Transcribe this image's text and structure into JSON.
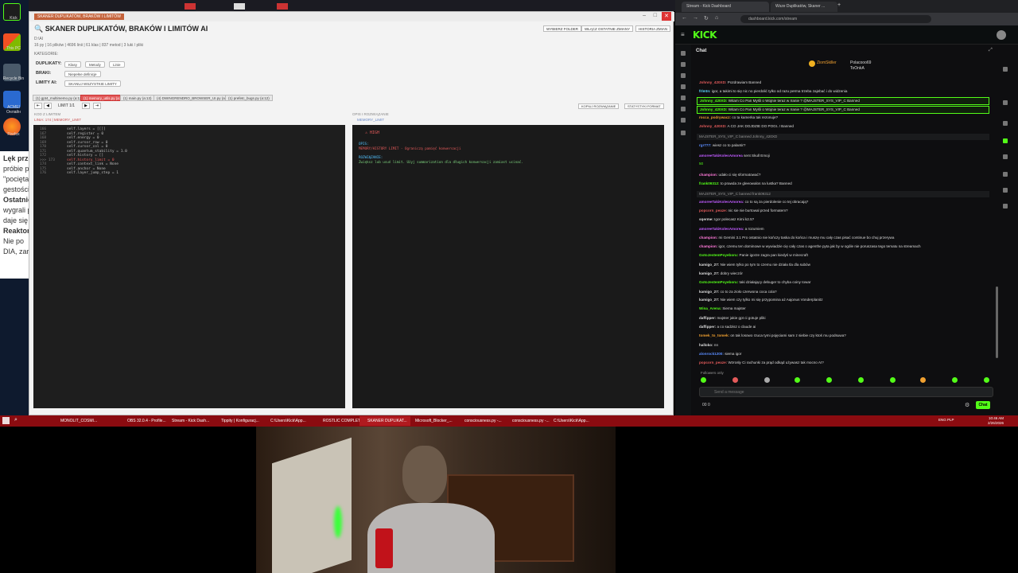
{
  "desktop": {
    "icons": [
      "Kick",
      "This PC",
      "Recycle Bin",
      "ACMEI Онлайн",
      "Firefox"
    ],
    "bg_lines": [
      "Lęk przed",
      "próbie pa",
      "\"pocięta\"",
      "gestości",
      "Ostatnio",
      "wygrali p",
      "daje się",
      "Reaktor",
      "Nie po",
      "DIA, zar"
    ]
  },
  "scanner": {
    "title_tag": "SKANER DUPLIKATÓW, BRAKÓW I LIMITÓW",
    "heading": "🔍 SKANER DUPLIKATÓW, BRAKÓW I LIMITÓW AI",
    "sub1": "D:\\AI",
    "sub2": "16 py | 16 plików | 4696 linii | 61 klas | 837 metod | 3 luki / pliki",
    "top_buttons": [
      "WYBIERZ FOLDER",
      "WŁĄCZ OSTATNIE ZMIANY",
      "HISTORIA ZMIAN"
    ],
    "kategorie": "KATEGORIE:",
    "rows": [
      {
        "label": "DUPLIKATY:",
        "chips": [
          "Klasy",
          "Metody",
          "Linie"
        ]
      },
      {
        "label": "BRAKI:",
        "chips": [
          "Niepełne definicje"
        ]
      },
      {
        "label": "LIMITY AI:",
        "chips": [
          "SKANUJ WSZYSTKIE LIMITY"
        ]
      }
    ],
    "file_tabs": [
      "(1) gpt4_multimemo.py (a:12)",
      "(1) memory_utils.py (a:2)",
      "(1) main.py (a:13)",
      "(4) DWINGRENDRO_BROWSER_UI.py (a:15)",
      "(1) prefetc_bugs.py (a:12)"
    ],
    "limit_label": "LIMIT 1/1",
    "nav": [
      "⇤",
      "◀",
      "▶",
      "⇥"
    ],
    "right_buttons": [
      "KOPIUJ ROZWIĄZANIE",
      "STATYSTYKI FORMAT"
    ],
    "left_head": "KOD Z LIMITEM",
    "left_sub": "LINIA: 174 | MEMORY_LIMIT",
    "right_head": "OPIS I ROZWIĄZANIE",
    "right_sub": "MEMORY_LIMIT",
    "code_lines": [
      {
        "n": "166",
        "t": "self.layers = [[]]"
      },
      {
        "n": "167",
        "t": "self.register = 0"
      },
      {
        "n": "168",
        "t": "self.energy = 0"
      },
      {
        "n": "169",
        "t": "self.cursor_row = 0"
      },
      {
        "n": "170",
        "t": "self.cursor_col = 0"
      },
      {
        "n": "171",
        "t": "self.quantum_stability = 1.0"
      },
      {
        "n": "172",
        "t": "self.history = []"
      },
      {
        "n": ">>> 173",
        "t": "self.history_limit = 0"
      },
      {
        "n": "174",
        "t": "self.context_link = None"
      },
      {
        "n": "175",
        "t": "self.anchor = None"
      },
      {
        "n": "176",
        "t": "self.layer_jump_step = 1"
      }
    ],
    "severity": "⚠ HIGH",
    "desc_label": "OPIS:",
    "desc_text": "MEMORY/HISTORY LIMIT - Ograniczą pamięć konwersacji",
    "fix_label": "ROZWIĄZANIE:",
    "fix_text": "Zwiększ lub usuń limit. Użyj summarization dla długich konwersacji zamiast ucinać."
  },
  "browser": {
    "tabs": [
      "Stream - Kick Dashboard",
      "Wsze Duplikatów, Skaner ...",
      "+"
    ],
    "url": "dashboard.kick.com/stream",
    "logo": "KICK",
    "chat_title": "Chat",
    "pinned": [
      "ZiomSkiller",
      "Polacooo69",
      "ToOnkA"
    ],
    "messages": [
      {
        "u": "Johnny_420XD:",
        "c": "#e05a5a",
        "t": "Pozdrawiam Banned",
        "style": ""
      },
      {
        "u": "frlmtn:",
        "c": "#5bd6ff",
        "t": "igor, a takimi to się nic no pierdolić tylko od razu perma trzeba zajebać i do widzenia",
        "style": ""
      },
      {
        "u": "Johnny_420XD:",
        "c": "#53fc18",
        "t": "Witam Co Pan Myśli o Wojnie teraz w Iranie ?  @MAJSTER_SYS_VIP_C Banned",
        "style": "boxed"
      },
      {
        "u": "Johnny_420XD:",
        "c": "#53fc18",
        "t": "Witam Co Pan Myśli o Wojnie teraz w Iranie ?  @MAJSTER_SYS_VIP_C Banned",
        "style": "boxed"
      },
      {
        "u": "rocca_podrywacz:",
        "c": "#f0a030",
        "t": "co ta kamerka tak rezonuje?",
        "style": ""
      },
      {
        "u": "Johnny_420XD:",
        "c": "#e05a5a",
        "t": "A CO JAK DOJDZIE DO POGI..! Banned",
        "style": ""
      },
      {
        "u": "",
        "c": "#999",
        "t": "MAJSTER_SYS_VIP_C banned Johnny_420XD",
        "style": "sys"
      },
      {
        "u": "rgr777:",
        "c": "#5b8dff",
        "t": "wiesz co to palantir?",
        "style": ""
      },
      {
        "u": "amoreeTakiKolesAmorea",
        "c": "#c05bff",
        "t": "sent Skull Emoji",
        "style": ""
      },
      {
        "u": "",
        "c": "#53fc18",
        "t": "50",
        "style": ""
      },
      {
        "u": "champion:",
        "c": "#ff7ad9",
        "t": "udało ci się sformatować?",
        "style": ""
      },
      {
        "u": "frank09312:",
        "c": "#53fc18",
        "t": "to prawda ze gleeowalos na lustka? Banned",
        "style": ""
      },
      {
        "u": "",
        "c": "#999",
        "t": "MAJSTER_SYS_VIP_C banned frank09312",
        "style": "sys"
      },
      {
        "u": "amoreeTakiKolesAmorea:",
        "c": "#c05bff",
        "t": "co to są za pierdolenie co tej obracają?",
        "style": ""
      },
      {
        "u": "popcorn_peaze:",
        "c": "#e05a5a",
        "t": "nic sie nie burtowal przed formatem?",
        "style": ""
      },
      {
        "u": "sqerme:",
        "c": "#ddd",
        "t": "Igor polecasz Kimi k2.5?",
        "style": ""
      },
      {
        "u": "amoreeTakiKolesAmorea:",
        "c": "#c05bff",
        "t": "a rozumiem",
        "style": ""
      },
      {
        "u": "champion:",
        "c": "#ff7ad9",
        "t": "mi Gemini 3.1 Pro ostatnio nie kończy taska do końca i muszę mu cały czas pisać continue bo chuj przerywa",
        "style": ""
      },
      {
        "u": "champion:",
        "c": "#ff7ad9",
        "t": "igor, czemu ten dominowe w wywiadzie cię cały czas o agenthe pyta jak by w ogóle nie poruszasa tego tematu na streamach",
        "style": ""
      },
      {
        "u": "GotoJestemPoyeboru:",
        "c": "#53fc18",
        "t": "Panie igorze zagra pan kiedyś w minecraft",
        "style": ""
      },
      {
        "u": "kamigo_27:",
        "c": "#ddd",
        "t": "Nie wiem tylko po tym to czemu nie działa tla dla subów",
        "style": ""
      },
      {
        "u": "kamigo_27:",
        "c": "#ddd",
        "t": "dobry wieczór",
        "style": ""
      },
      {
        "u": "GotoJestemPoyeboru:",
        "c": "#53fc18",
        "t": "taki działający debuger to chyba coiny towar",
        "style": ""
      },
      {
        "u": "kamigo_27:",
        "c": "#ddd",
        "t": "co to za zioło czerwona coca cola?",
        "style": ""
      },
      {
        "u": "kamigo_27:",
        "c": "#ddd",
        "t": "Nie wiem czy tylko mi się przypomina aż Aajonus Vonderplanitz",
        "style": ""
      },
      {
        "u": "Wina_Arena:",
        "c": "#53fc18",
        "t": "Siema majster",
        "style": ""
      },
      {
        "u": "daffipper:",
        "c": "#ddd",
        "t": "majster jakie gpt ci gotuje pliki",
        "style": ""
      },
      {
        "u": "daffipper:",
        "c": "#ddd",
        "t": "a co sadzisz o claude ai",
        "style": ""
      },
      {
        "u": "tomek_to_tomek:",
        "c": "#f0a030",
        "t": "on tak losowo rzuca tymi pojęciami sam z siebie czy ktoś mu podsuwa?",
        "style": ""
      },
      {
        "u": "halloko:",
        "c": "#ddd",
        "t": "nn",
        "style": ""
      },
      {
        "u": "alonrock1200:",
        "c": "#5b8dff",
        "t": "siema igor",
        "style": ""
      },
      {
        "u": "popcorn_peaze:",
        "c": "#e05a5a",
        "t": "Wzrosły Ci rachunki za prąd odkąd używasz tak mocno AI?",
        "style": ""
      }
    ],
    "followers_only": "Followers only",
    "send_placeholder": "Send a message",
    "chat_button": "Chat",
    "footer": "00   0"
  },
  "taskbar": {
    "items": [
      "MONOLIT_COSMI...",
      "OBS 32.0.4 - Profile...",
      "Stream - Kick Dash...",
      "Tippity | Konfiguracj...",
      "C:\\Users\\Kick\\App...",
      "ROSTLIC COMPLET...",
      "SKANER DUPLIKAT...",
      "Microsoft_Blocker_...",
      "consciousness.py -...",
      "consciousness.py -...",
      "C:\\Users\\Kick\\App..."
    ],
    "active_index": 6,
    "clock_time": "10:46 AM",
    "clock_date": "2/26/2026",
    "lang": "ENG PLP"
  }
}
